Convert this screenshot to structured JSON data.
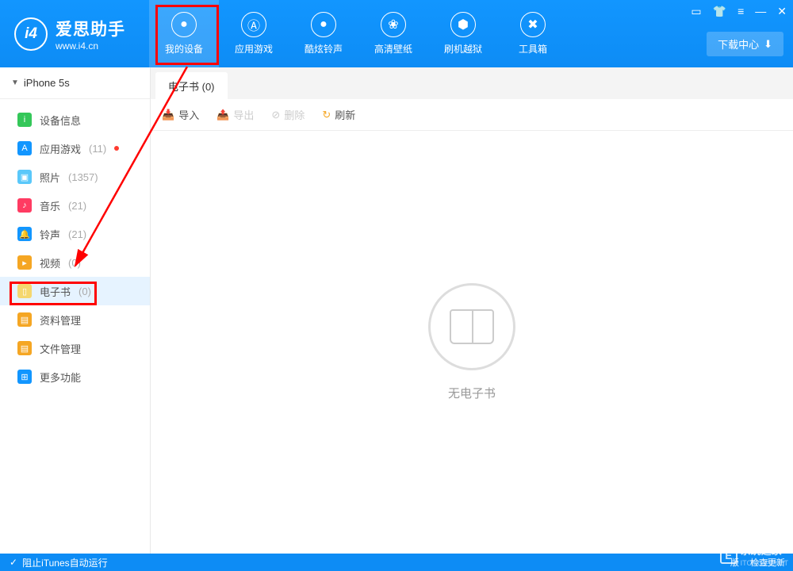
{
  "app": {
    "title": "爱思助手",
    "url": "www.i4.cn",
    "download_center": "下载中心"
  },
  "nav": [
    {
      "id": "my-device",
      "label": "我的设备",
      "icon": "apple",
      "active": true
    },
    {
      "id": "apps",
      "label": "应用游戏",
      "icon": "appstore"
    },
    {
      "id": "ringtones",
      "label": "酷炫铃声",
      "icon": "bell"
    },
    {
      "id": "wallpapers",
      "label": "高清壁纸",
      "icon": "flower"
    },
    {
      "id": "jailbreak",
      "label": "刷机越狱",
      "icon": "box"
    },
    {
      "id": "toolbox",
      "label": "工具箱",
      "icon": "wrench"
    }
  ],
  "sidebar": {
    "device": "iPhone 5s",
    "items": [
      {
        "label": "设备信息",
        "count": "",
        "color": "#34c759",
        "icon": "i",
        "badge": false
      },
      {
        "label": "应用游戏",
        "count": "(11)",
        "color": "#1296ff",
        "icon": "A",
        "badge": true
      },
      {
        "label": "照片",
        "count": "(1357)",
        "color": "#5ac8fa",
        "icon": "▣",
        "badge": false
      },
      {
        "label": "音乐",
        "count": "(21)",
        "color": "#ff3b62",
        "icon": "♪",
        "badge": false
      },
      {
        "label": "铃声",
        "count": "(21)",
        "color": "#1296ff",
        "icon": "🔔",
        "badge": false
      },
      {
        "label": "视频",
        "count": "(0)",
        "color": "#f5a623",
        "icon": "▸",
        "badge": false
      },
      {
        "label": "电子书",
        "count": "(0)",
        "color": "#f5d76e",
        "icon": "▯",
        "badge": false,
        "selected": true
      },
      {
        "label": "资料管理",
        "count": "",
        "color": "#f5a623",
        "icon": "▤",
        "badge": false
      },
      {
        "label": "文件管理",
        "count": "",
        "color": "#f5a623",
        "icon": "▤",
        "badge": false
      },
      {
        "label": "更多功能",
        "count": "",
        "color": "#1296ff",
        "icon": "⊞",
        "badge": false
      }
    ]
  },
  "content": {
    "tab_label": "电子书 (0)",
    "toolbar": {
      "import": "导入",
      "export": "导出",
      "delete": "删除",
      "refresh": "刷新"
    },
    "empty_text": "无电子书"
  },
  "footer": {
    "itunes_text": "阻止iTunes自动运行",
    "right1": "版",
    "right2": "检查更新"
  },
  "watermark": {
    "brand": "系统之家",
    "sub": "ITONG更新.ET"
  }
}
